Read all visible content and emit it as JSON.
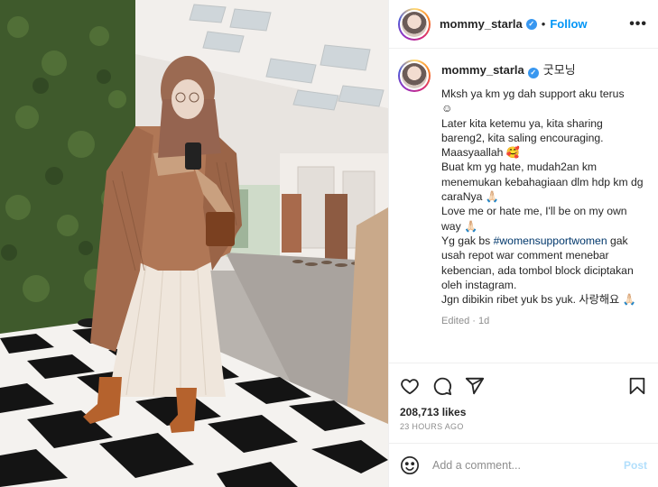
{
  "post": {
    "username": "mommy_starla",
    "follow_label": "Follow",
    "more_label": "•••",
    "dot": "•",
    "verified_glyph": "✓"
  },
  "caption": {
    "username": "mommy_starla",
    "korean_title": "굿모닝",
    "text_part1": "Mksh ya km yg dah support aku terus\n☺\nLater kita ketemu ya, kita sharing bareng2, kita saling encouraging. Maasyaallah 🥰\nBuat km yg hate, mudah2an km menemukan kebahagiaan dlm hdp km dg caraNya 🙏🏻\nLove me or hate me, I'll be on my own way 🙏🏻\nYg gak bs ",
    "hashtag": "#womensupportwomen",
    "text_part2": " gak usah repot war comment menebar kebencian, ada tombol block diciptakan oleh instagram.\nJgn dibikin ribet yuk bs yuk. 사랑해요 🙏🏻",
    "edited": "Edited · 1d"
  },
  "actions": {
    "likes": "208,713 likes",
    "time": "23 HOURS AGO",
    "icons": [
      "heart-icon",
      "comment-icon",
      "share-icon",
      "bookmark-icon"
    ]
  },
  "comment_box": {
    "placeholder": "Add a comment...",
    "post_label": "Post"
  },
  "colors": {
    "link_blue": "#0095f6",
    "hashtag": "#00376b",
    "muted": "#8e8e8e",
    "post_disabled": "#b2dffc"
  }
}
